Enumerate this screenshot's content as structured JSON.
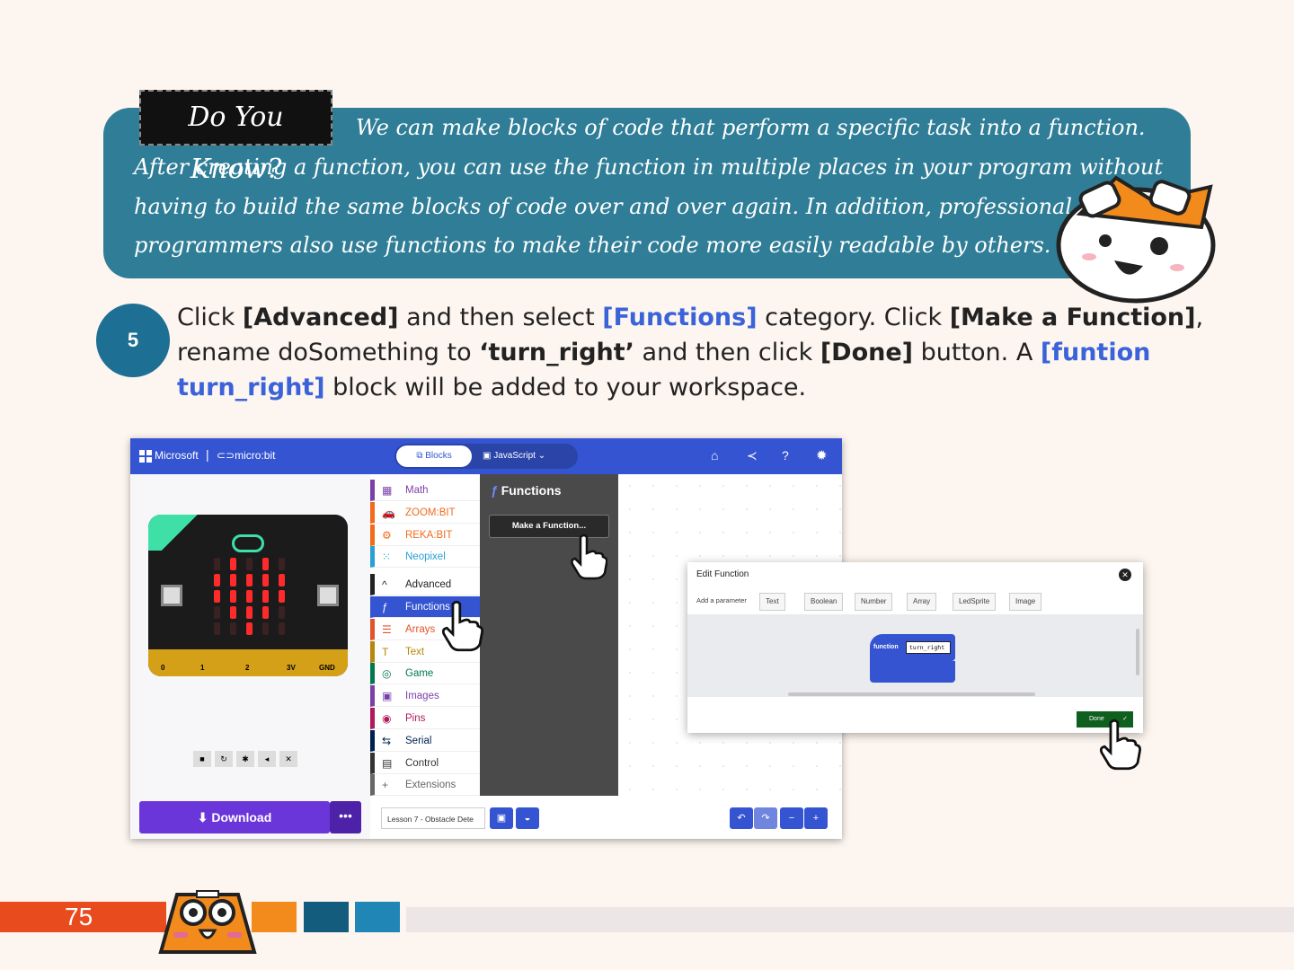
{
  "info": {
    "badge": "Do You Know?",
    "line1": "We can make blocks of code that perform a specific task into a function.",
    "line2": "After creating a function, you can use the function in multiple places in your program without",
    "line3": "having to build the same blocks of code over and over again. In addition, professional",
    "line4": "programmers also use functions to make their code more easily readable by others."
  },
  "step": {
    "number": "5",
    "l1_a": "Click ",
    "l1_b": "[Advanced]",
    "l1_c": " and then select ",
    "l1_d": "[Functions]",
    "l1_e": " category. Click ",
    "l1_f": "[Make a Function]",
    "l1_g": ",",
    "l2_a": "rename doSomething to ",
    "l2_b": "‘turn_right’",
    "l2_c": " and then click ",
    "l2_d": "[Done]",
    "l2_e": " button.  A ",
    "l2_f": "[funtion",
    "l3_a": "turn_right]",
    "l3_b": " block will be added to your workspace."
  },
  "editor": {
    "brand": "Microsoft",
    "product": "micro:bit",
    "tab_blocks": "Blocks",
    "tab_js": "JavaScript",
    "categories": [
      {
        "label": "Math",
        "color": "#7b3fa8",
        "icon": "▦"
      },
      {
        "label": "ZOOM:BIT",
        "color": "#f26b1d",
        "icon": "🚗"
      },
      {
        "label": "REKA:BIT",
        "color": "#f26b1d",
        "icon": "⚙"
      },
      {
        "label": "Neopixel",
        "color": "#2c9ed4",
        "icon": "⁙"
      },
      {
        "label": "Advanced",
        "color": "#222222",
        "icon": "^"
      },
      {
        "label": "Functions",
        "color": "#3454d1",
        "icon": "ƒ"
      },
      {
        "label": "Arrays",
        "color": "#e0542b",
        "icon": "☰"
      },
      {
        "label": "Text",
        "color": "#b8860b",
        "icon": "T"
      },
      {
        "label": "Game",
        "color": "#007a4d",
        "icon": "◎"
      },
      {
        "label": "Images",
        "color": "#7b3fa8",
        "icon": "▣"
      },
      {
        "label": "Pins",
        "color": "#b0185c",
        "icon": "◉"
      },
      {
        "label": "Serial",
        "color": "#002050",
        "icon": "⇆"
      },
      {
        "label": "Control",
        "color": "#333333",
        "icon": "▤"
      },
      {
        "label": "Extensions",
        "color": "#666666",
        "icon": "+"
      }
    ],
    "flyout_title": "Functions",
    "make_function": "Make a Function...",
    "download": "Download",
    "project_name": "Lesson 7 - Obstacle Dete",
    "pins": [
      "0",
      "1",
      "2",
      "3V",
      "GND"
    ]
  },
  "dialog": {
    "title": "Edit Function",
    "add_param": "Add a parameter",
    "types": [
      "Text",
      "Boolean",
      "Number",
      "Array",
      "LedSprite",
      "Image"
    ],
    "block_keyword": "function",
    "block_name": "turn_right",
    "done": "Done"
  },
  "footer": {
    "page": "75"
  },
  "colors": {
    "info_bg": "#2f7d96",
    "accent_blue": "#3b63d9",
    "makecode_blue": "#3454d1",
    "download_purple": "#6a35d9",
    "done_green": "#0f5f1f",
    "footer_red": "#e84c1e"
  }
}
